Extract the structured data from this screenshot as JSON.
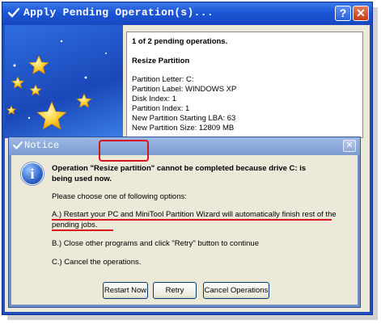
{
  "window": {
    "title": "Apply Pending Operation(s)...",
    "help_label": "?",
    "close_label": "✕"
  },
  "operation": {
    "count_text": "1 of 2 pending operations.",
    "name": "Resize Partition",
    "details": [
      "Partition Letter: C:",
      "Partition Label: WINDOWS XP",
      "Disk Index: 1",
      "Partition Index: 1",
      "New Partition Starting LBA: 63",
      "New Partition Size: 12809 MB"
    ]
  },
  "notice": {
    "title": "Notice",
    "close_label": "✕",
    "icon": "info-icon",
    "icon_glyph": "i",
    "message_line1": "Operation \"Resize partition\" cannot be completed because drive C: is",
    "message_line2": "being used now.",
    "prompt": "Please choose one of following options:",
    "option_a_line1": "A.) Restart your PC and MiniTool Partition Wizard will automatically finish rest of the",
    "option_a_line2": "pending jobs.",
    "option_b": "B.) Close other programs and click \"Retry\" button to continue",
    "option_c": "C.) Cancel the operations.",
    "buttons": {
      "restart": "Restart Now",
      "retry": "Retry",
      "cancel": "Cancel Operations"
    }
  },
  "colors": {
    "title_bar": "#1b56d6",
    "highlight": "#d8141e",
    "dialog_bg": "#ece9d8"
  }
}
